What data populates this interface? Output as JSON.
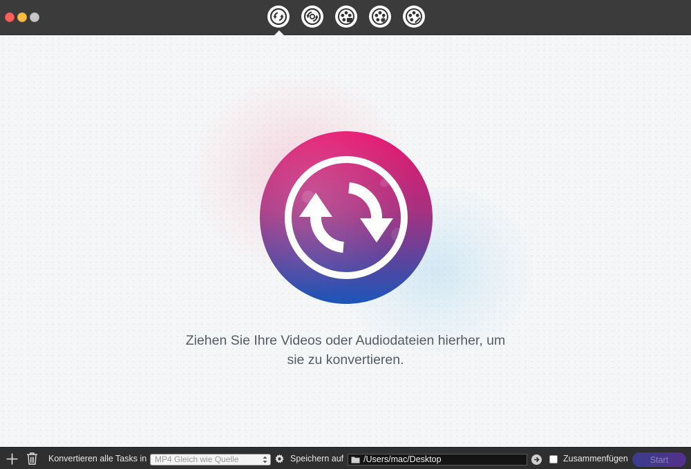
{
  "toolbar": {
    "tools": [
      {
        "name": "convert-icon"
      },
      {
        "name": "convert-settings-icon"
      },
      {
        "name": "film-reel-icon"
      },
      {
        "name": "film-reel-snowflake-icon"
      },
      {
        "name": "film-reel-edit-icon"
      }
    ]
  },
  "main": {
    "drop_text_line1": "Ziehen Sie Ihre Videos oder Audiodateien hierher, um",
    "drop_text_line2": "sie zu konvertieren."
  },
  "bottombar": {
    "convert_all_label": "Konvertieren alle Tasks in",
    "format_select_value": "MP4 Gleich wie Quelle",
    "save_label": "Speichern auf",
    "save_path": "/Users/mac/Desktop",
    "merge_label": "Zusammenfügen",
    "start_label": "Start"
  },
  "colors": {
    "titlebar": "#3b3b3b",
    "bottombar": "#2f2f30",
    "accent_pink": "#e8166e",
    "accent_blue": "#1a56b8"
  }
}
